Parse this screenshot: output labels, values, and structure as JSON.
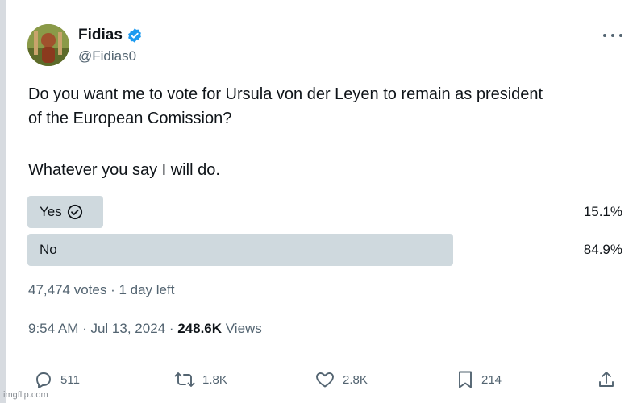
{
  "author": {
    "name": "Fidias",
    "handle": "@Fidias0",
    "verified": true,
    "verified_color": "#1d9bf0"
  },
  "post": {
    "line1": "Do you want me to vote for Ursula von der Leyen to remain as president",
    "line2": "of the European Comission?",
    "line3": "Whatever you say I will do."
  },
  "poll": {
    "options": [
      {
        "label": "Yes",
        "percent_text": "15.1%",
        "value": 15.1,
        "selected": true
      },
      {
        "label": "No",
        "percent_text": "84.9%",
        "value": 84.9,
        "selected": false
      }
    ],
    "summary": "47,474 votes · 1 day left"
  },
  "timestamp": {
    "text": "9:54 AM · Jul 13, 2024 · ",
    "views_count": "248.6K",
    "views_label": " Views"
  },
  "actions": {
    "replies": "511",
    "reposts": "1.8K",
    "likes": "2.8K",
    "bookmarks": "214"
  },
  "icons": {
    "more": "more-dots-icon",
    "verified": "verified-badge-icon",
    "reply": "reply-icon",
    "repost": "repost-icon",
    "like": "heart-icon",
    "bookmark": "bookmark-icon",
    "share": "share-icon",
    "check": "check-circle-icon"
  },
  "colors": {
    "text": "#0f1419",
    "secondary": "#536471",
    "poll_bar": "#cfd9de",
    "accent": "#1d9bf0"
  },
  "watermark": "imgflip.com"
}
